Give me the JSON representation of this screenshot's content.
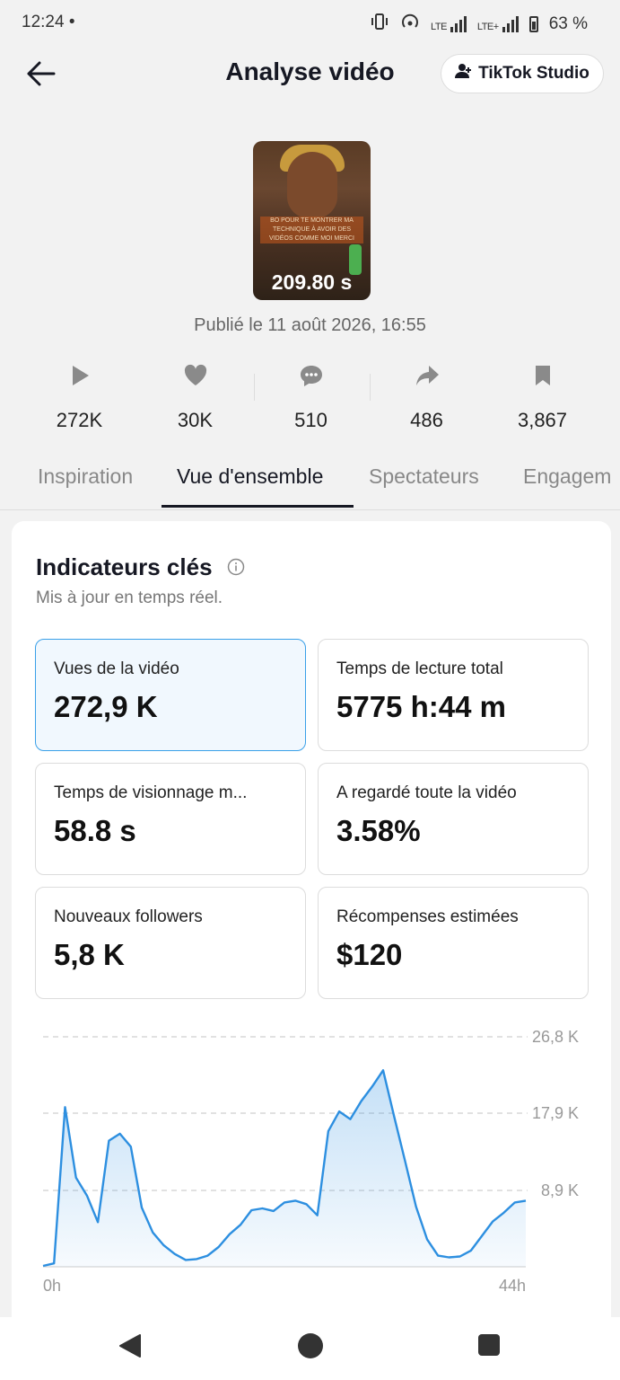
{
  "status": {
    "time": "12:24 •",
    "lte1": "LTE",
    "lte2": "LTE+",
    "battery": "63 %"
  },
  "header": {
    "title": "Analyse vidéo",
    "studio_label": "TikTok Studio"
  },
  "video": {
    "duration": "209.80 s",
    "overlay_text": "BO POUR TE MONTRER MA TECHNIQUE À AVOIR DES VIDÉOS COMME MOI MERCI",
    "published": "Publié le 11 août 2026, 16:55"
  },
  "stats": [
    {
      "icon": "play-icon",
      "value": "272K"
    },
    {
      "icon": "heart-icon",
      "value": "30K"
    },
    {
      "icon": "comment-icon",
      "value": "510"
    },
    {
      "icon": "share-icon",
      "value": "486"
    },
    {
      "icon": "bookmark-icon",
      "value": "3,867"
    }
  ],
  "tabs": [
    {
      "label": "Inspiration",
      "active": false
    },
    {
      "label": "Vue d'ensemble",
      "active": true
    },
    {
      "label": "Spectateurs",
      "active": false
    },
    {
      "label": "Engagem",
      "active": false
    }
  ],
  "key_metrics": {
    "title": "Indicateurs clés",
    "subtitle": "Mis à jour en temps réel.",
    "items": [
      {
        "label": "Vues de la vidéo",
        "value": "272,9 K",
        "selected": true
      },
      {
        "label": "Temps de lecture total",
        "value": "5775 h:44 m",
        "selected": false
      },
      {
        "label": "Temps de visionnage m...",
        "value": "58.8 s",
        "selected": false
      },
      {
        "label": "A regardé toute la vidéo",
        "value": "3.58%",
        "selected": false
      },
      {
        "label": "Nouveaux followers",
        "value": "5,8 K",
        "selected": false
      },
      {
        "label": "Récompenses estimées",
        "value": "$120",
        "selected": false
      }
    ]
  },
  "chart_data": {
    "type": "area",
    "x_start_label": "0h",
    "x_end_label": "44h",
    "y_ticks": [
      "26,8 K",
      "17,9 K",
      "8,9 K"
    ],
    "y_tick_values": [
      26800,
      17900,
      8900
    ],
    "ylim": [
      0,
      26800
    ],
    "xlim": [
      0,
      44
    ],
    "color": "#2d8fe0",
    "x": [
      0,
      1,
      2,
      3,
      4,
      5,
      6,
      7,
      8,
      9,
      10,
      11,
      12,
      13,
      14,
      15,
      16,
      17,
      18,
      19,
      20,
      21,
      22,
      23,
      24,
      25,
      26,
      27,
      28,
      29,
      30,
      31,
      32,
      33,
      34,
      35,
      36,
      37,
      38,
      39,
      40,
      41,
      42,
      43,
      44
    ],
    "values": [
      100,
      400,
      18600,
      10400,
      8300,
      5200,
      14700,
      15500,
      14000,
      6900,
      4000,
      2500,
      1500,
      800,
      900,
      1300,
      2300,
      3800,
      4900,
      6600,
      6800,
      6500,
      7500,
      7700,
      7300,
      6000,
      15800,
      18100,
      17200,
      19300,
      21000,
      22900,
      17500,
      12300,
      7000,
      3200,
      1300,
      1100,
      1200,
      1900,
      3600,
      5300,
      6300,
      7500,
      7700
    ]
  },
  "navbar": {
    "back": "back-nav-icon",
    "home": "home-nav-icon",
    "recents": "recents-nav-icon"
  }
}
